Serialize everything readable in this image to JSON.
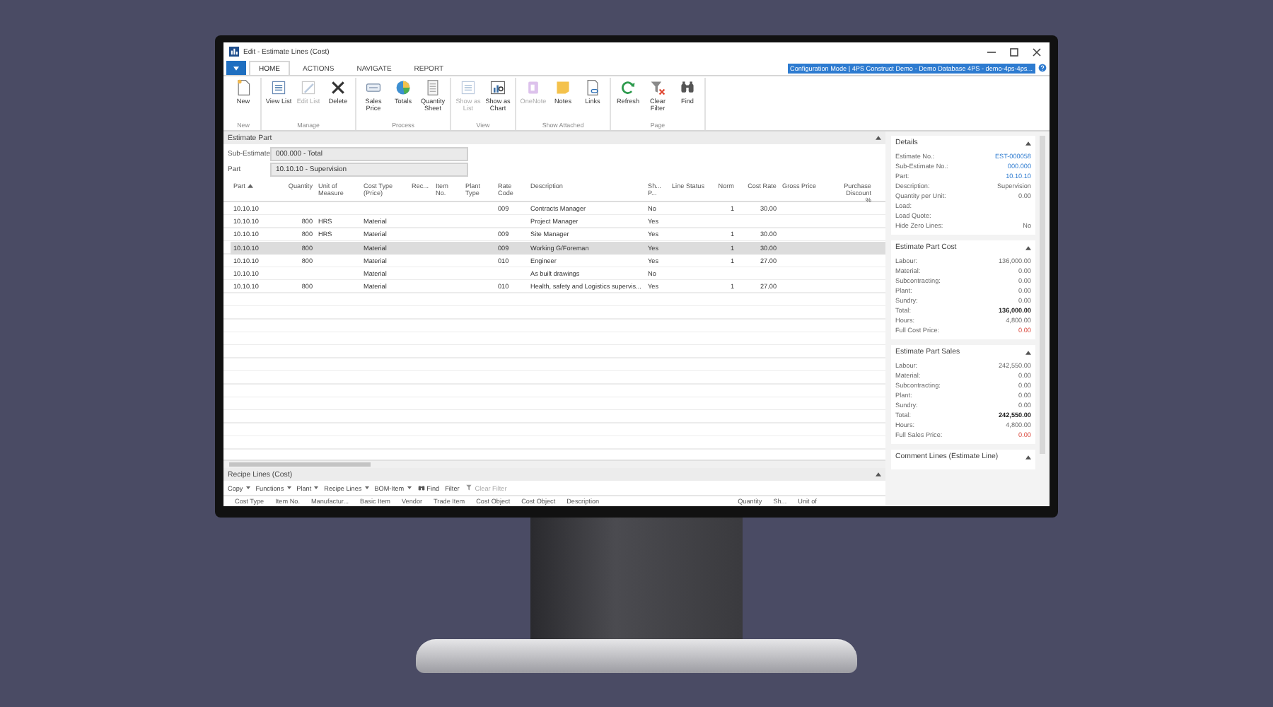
{
  "window": {
    "title": "Edit - Estimate Lines (Cost)"
  },
  "tabs": [
    {
      "label": "HOME",
      "selected": true
    },
    {
      "label": "ACTIONS",
      "selected": false
    },
    {
      "label": "NAVIGATE",
      "selected": false
    },
    {
      "label": "REPORT",
      "selected": false
    }
  ],
  "banner": "Configuration Mode | 4PS Construct Demo - Demo Database 4PS - demo-4ps-4ps...",
  "ribbon": [
    {
      "label": "New",
      "items": [
        {
          "label": "New",
          "kind": "new",
          "disabled": false
        }
      ]
    },
    {
      "label": "Manage",
      "items": [
        {
          "label": "View List",
          "kind": "view-list",
          "disabled": false
        },
        {
          "label": "Edit List",
          "kind": "edit-list",
          "disabled": true
        },
        {
          "label": "Delete",
          "kind": "delete",
          "disabled": false
        }
      ]
    },
    {
      "label": "Process",
      "items": [
        {
          "label": "Sales Price",
          "kind": "price",
          "disabled": false
        },
        {
          "label": "Totals",
          "kind": "totals",
          "disabled": false
        },
        {
          "label": "Quantity Sheet",
          "kind": "sheet",
          "disabled": false
        }
      ]
    },
    {
      "label": "View",
      "items": [
        {
          "label": "Show as List",
          "kind": "show-list",
          "disabled": true
        },
        {
          "label": "Show as Chart",
          "kind": "chart",
          "disabled": false
        }
      ]
    },
    {
      "label": "Show Attached",
      "items": [
        {
          "label": "OneNote",
          "kind": "onenote",
          "disabled": true
        },
        {
          "label": "Notes",
          "kind": "notes",
          "disabled": false
        },
        {
          "label": "Links",
          "kind": "links",
          "disabled": false
        }
      ]
    },
    {
      "label": "Page",
      "items": [
        {
          "label": "Refresh",
          "kind": "refresh",
          "disabled": false
        },
        {
          "label": "Clear Filter",
          "kind": "clear-filter",
          "disabled": false
        },
        {
          "label": "Find",
          "kind": "find",
          "disabled": false
        }
      ]
    }
  ],
  "estimate_part": {
    "title": "Estimate Part",
    "expanded": true,
    "fields": [
      {
        "label": "Sub-Estimate",
        "value": "000.000 - Total"
      },
      {
        "label": "Part",
        "value": "10.10.10 - Supervision"
      }
    ],
    "columns": [
      {
        "label": "Part",
        "sorted": true
      },
      {
        "label": "Quantity"
      },
      {
        "label": "Unit of Measure"
      },
      {
        "label": "Cost Type (Price)"
      },
      {
        "label": "Rec..."
      },
      {
        "label": "Item No."
      },
      {
        "label": "Plant Type"
      },
      {
        "label": "Rate Code"
      },
      {
        "label": "Description"
      },
      {
        "label": "Sh... P..."
      },
      {
        "label": "Line Status"
      },
      {
        "label": "Norm"
      },
      {
        "label": "Cost Rate"
      },
      {
        "label": "Gross Price"
      },
      {
        "label": "Purchase Discount %"
      }
    ],
    "rows": [
      {
        "selected": false,
        "cells": {
          "part": "10.10.10",
          "rate_code": "009",
          "description": "Contracts Manager",
          "sh": "No",
          "norm": "1",
          "cost_rate": "30.00"
        }
      },
      {
        "selected": false,
        "cells": {
          "part": "10.10.10",
          "quantity": "800",
          "unit": "HRS",
          "cost_type": "Material",
          "description": "Project Manager",
          "sh": "Yes"
        }
      },
      {
        "selected": false,
        "cells": {
          "part": "10.10.10",
          "quantity": "800",
          "unit": "HRS",
          "cost_type": "Material",
          "rate_code": "009",
          "description": "Site Manager",
          "sh": "Yes",
          "norm": "1",
          "cost_rate": "30.00"
        }
      },
      {
        "selected": true,
        "cells": {
          "part": "10.10.10",
          "quantity": "800",
          "cost_type": "Material",
          "rate_code": "009",
          "description": "Working G/Foreman",
          "sh": "Yes",
          "norm": "1",
          "cost_rate": "30.00"
        }
      },
      {
        "selected": false,
        "cells": {
          "part": "10.10.10",
          "quantity": "800",
          "cost_type": "Material",
          "rate_code": "010",
          "description": "Engineer",
          "sh": "Yes",
          "norm": "1",
          "cost_rate": "27.00"
        }
      },
      {
        "selected": false,
        "cells": {
          "part": "10.10.10",
          "cost_type": "Material",
          "description": "As built drawings",
          "sh": "No"
        }
      },
      {
        "selected": false,
        "cells": {
          "part": "10.10.10",
          "quantity": "800",
          "cost_type": "Material",
          "rate_code": "010",
          "description": "Health, safety and Logistics supervis...",
          "sh": "Yes",
          "norm": "1",
          "cost_rate": "27.00"
        }
      }
    ]
  },
  "recipe_lines": {
    "title": "Recipe Lines (Cost)",
    "expanded": true,
    "toolbar": [
      {
        "label": "Copy",
        "kind": "menu",
        "disabled": false
      },
      {
        "label": "Functions",
        "kind": "menu",
        "disabled": false
      },
      {
        "label": "Plant",
        "kind": "menu",
        "disabled": false
      },
      {
        "label": "Recipe Lines",
        "kind": "menu",
        "disabled": false
      },
      {
        "label": "BOM-Item",
        "kind": "menu",
        "disabled": false
      },
      {
        "label": "Find",
        "kind": "find",
        "disabled": false
      },
      {
        "label": "Filter",
        "kind": "plain",
        "disabled": false
      },
      {
        "label": "Clear Filter",
        "kind": "clear-filter",
        "disabled": true
      }
    ],
    "columns": [
      "Cost Type",
      "Item No.",
      "Manufactur...",
      "Basic Item",
      "Vendor",
      "Trade Item",
      "Cost Object",
      "Cost Object",
      "Description",
      "Quantity",
      "Sh...",
      "Unit of"
    ]
  },
  "factbox": [
    {
      "title": "Details",
      "expanded": true,
      "rows": [
        {
          "label": "Estimate No.:",
          "value": "EST-000058",
          "kind": "link"
        },
        {
          "label": "Sub-Estimate No.:",
          "value": "000.000",
          "kind": "link"
        },
        {
          "label": "Part:",
          "value": "10.10.10",
          "kind": "link"
        },
        {
          "label": "Description:",
          "value": "Supervision",
          "kind": "plain"
        },
        {
          "label": "Quantity per Unit:",
          "value": "0.00",
          "kind": "plain"
        },
        {
          "label": "Load:"
        },
        {
          "label": "Load Quote:"
        },
        {
          "label": "Hide Zero Lines:",
          "value": "No",
          "kind": "plain"
        }
      ]
    },
    {
      "title": "Estimate Part Cost",
      "expanded": true,
      "rows": [
        {
          "label": "Labour:",
          "value": "136,000.00",
          "kind": "plain"
        },
        {
          "label": "Material:",
          "value": "0.00",
          "kind": "plain"
        },
        {
          "label": "Subcontracting:",
          "value": "0.00",
          "kind": "plain"
        },
        {
          "label": "Plant:",
          "value": "0.00",
          "kind": "plain"
        },
        {
          "label": "Sundry:",
          "value": "0.00",
          "kind": "plain"
        },
        {
          "label": "Total:",
          "value": "136,000.00",
          "kind": "bold"
        },
        {
          "label": "Hours:",
          "value": "4,800.00",
          "kind": "plain"
        },
        {
          "label": "Full Cost Price:",
          "value": "0.00",
          "kind": "negative"
        }
      ]
    },
    {
      "title": "Estimate Part Sales",
      "expanded": true,
      "rows": [
        {
          "label": "Labour:",
          "value": "242,550.00",
          "kind": "plain"
        },
        {
          "label": "Material:",
          "value": "0.00",
          "kind": "plain"
        },
        {
          "label": "Subcontracting:",
          "value": "0.00",
          "kind": "plain"
        },
        {
          "label": "Plant:",
          "value": "0.00",
          "kind": "plain"
        },
        {
          "label": "Sundry:",
          "value": "0.00",
          "kind": "plain"
        },
        {
          "label": "Total:",
          "value": "242,550.00",
          "kind": "bold"
        },
        {
          "label": "Hours:",
          "value": "4,800.00",
          "kind": "plain"
        },
        {
          "label": "Full Sales Price:",
          "value": "0.00",
          "kind": "negative"
        }
      ]
    },
    {
      "title": "Comment Lines (Estimate Line)",
      "expanded": true
    }
  ]
}
